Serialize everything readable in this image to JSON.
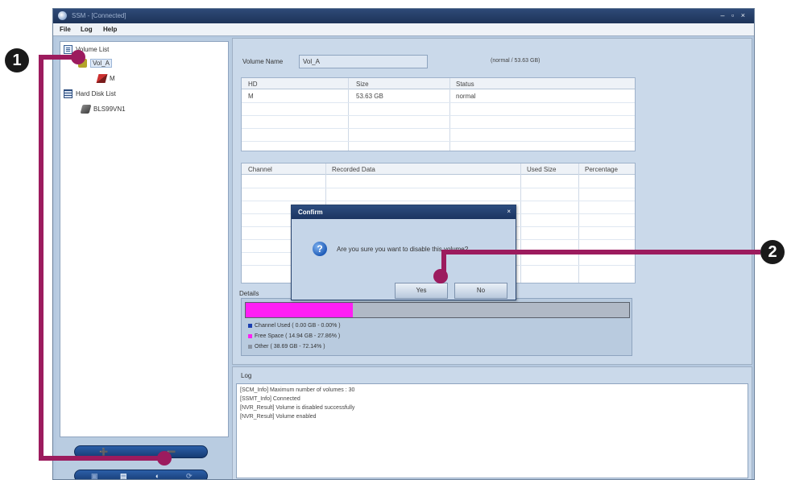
{
  "window": {
    "title": "SSM - [Connected]",
    "controls": "– ▫ ×"
  },
  "menu": {
    "file": "File",
    "log": "Log",
    "help": "Help"
  },
  "tree": {
    "volume_list": "Volume List",
    "volume": "Vol_A",
    "volume_child": "M",
    "hard_disk_list": "Hard Disk List",
    "disk": "BLS99VN1"
  },
  "sidebar_buttons": {
    "add": "➕",
    "remove": "➖",
    "format": "▤",
    "disable": "◐",
    "refresh": "⟳",
    "more": "▣"
  },
  "volume_info": {
    "name_label": "Volume Name",
    "name_value": "Vol_A",
    "status_text": "(normal / 53.63 GB)"
  },
  "hd_table": {
    "headers": [
      "HD",
      "Size",
      "Status"
    ],
    "rows": [
      [
        "M",
        "53.63 GB",
        "normal"
      ]
    ]
  },
  "channel_table": {
    "headers": [
      "Channel",
      "Recorded Data",
      "Used Size",
      "Percentage"
    ]
  },
  "details": {
    "label": "Details",
    "fill_fraction": 0.279,
    "fill_color": "#ff1ef4",
    "legend": [
      {
        "text": "Channel Used ( 0.00 GB - 0.00% )",
        "color": "#1a3fb0"
      },
      {
        "text": "Free Space ( 14.94 GB - 27.86% )",
        "color": "#ff1ef4"
      },
      {
        "text": "Other ( 38.69 GB - 72.14% )",
        "color": "#8a94a2"
      }
    ]
  },
  "dialog": {
    "title": "Confirm",
    "close": "×",
    "icon": "question-icon",
    "icon_glyph": "?",
    "message": "Are you sure you want to disable this volume?",
    "yes": "Yes",
    "no": "No"
  },
  "log": {
    "label": "Log",
    "lines": [
      "[SCM_Info] Maximum number of volumes : 30",
      "[SSMT_Info] Connected",
      "[NVR_Result] Volume is disabled successfully",
      "[NVR_Result] Volume enabled"
    ]
  },
  "annotations": {
    "step1": "1",
    "step2": "2",
    "color": "#9c1b5e"
  }
}
